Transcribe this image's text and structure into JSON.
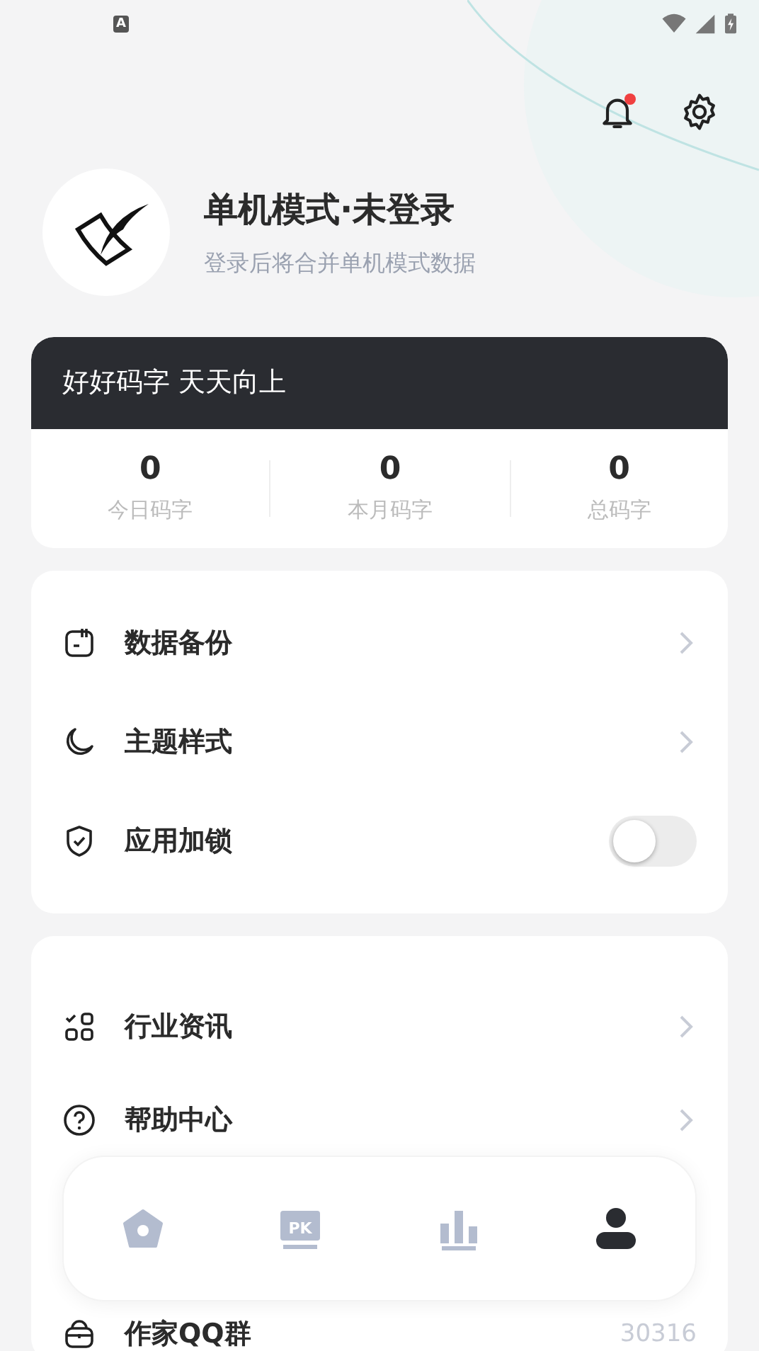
{
  "status_bar": {
    "keyboard_indicator": "A"
  },
  "header": {
    "notification_dot": true
  },
  "profile": {
    "name": "单机模式·未登录",
    "subtitle": "登录后将合并单机模式数据"
  },
  "stats_card": {
    "slogan": "好好码字 天天向上",
    "stats": [
      {
        "value": "0",
        "label": "今日码字"
      },
      {
        "value": "0",
        "label": "本月码字"
      },
      {
        "value": "0",
        "label": "总码字"
      }
    ]
  },
  "settings_menu": [
    {
      "kind": "link",
      "label": "数据备份"
    },
    {
      "kind": "link",
      "label": "主题样式"
    },
    {
      "kind": "switch",
      "label": "应用加锁",
      "on": false
    }
  ],
  "info_menu": [
    {
      "kind": "link",
      "label": "行业资讯"
    },
    {
      "kind": "link",
      "label": "帮助中心"
    },
    {
      "kind": "value",
      "label": "作家QQ群",
      "value": "30316"
    }
  ],
  "bottom_nav": [
    {
      "selected": false
    },
    {
      "label": "PK",
      "selected": false
    },
    {
      "selected": false
    },
    {
      "selected": true
    }
  ]
}
